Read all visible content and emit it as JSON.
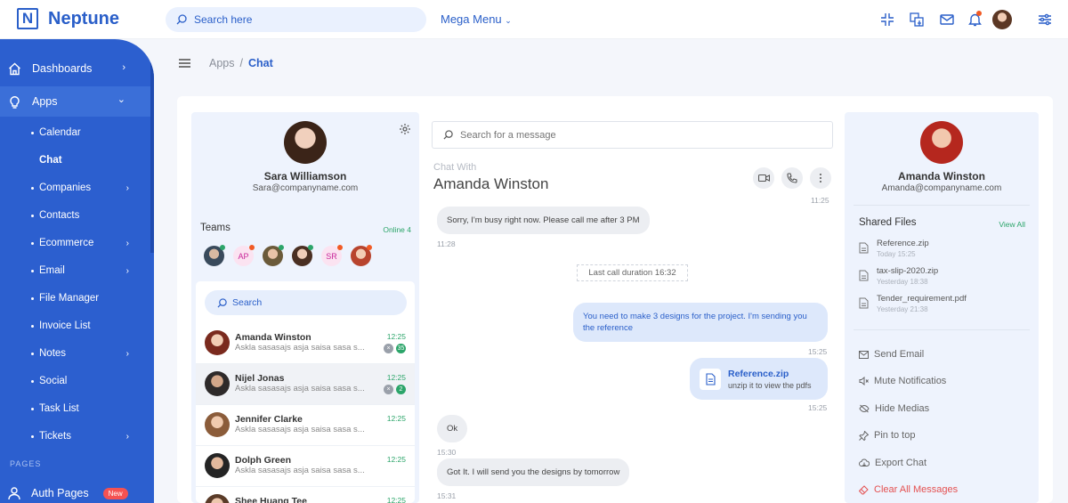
{
  "brand": {
    "mark": "N",
    "name": "Neptune"
  },
  "topbar": {
    "search_placeholder": "Search here",
    "mega_menu": "Mega Menu"
  },
  "sidebar": {
    "dashboards": "Dashboards",
    "apps": "Apps",
    "apps_items": [
      {
        "label": "Calendar"
      },
      {
        "label": "Chat"
      },
      {
        "label": "Companies"
      },
      {
        "label": "Contacts"
      },
      {
        "label": "Ecommerce"
      },
      {
        "label": "Email"
      },
      {
        "label": "File Manager"
      },
      {
        "label": "Invoice List"
      },
      {
        "label": "Notes"
      },
      {
        "label": "Social"
      },
      {
        "label": "Task List"
      },
      {
        "label": "Tickets"
      }
    ],
    "section_pages": "PAGES",
    "auth_pages": "Auth Pages",
    "auth_badge": "New"
  },
  "breadcrumb": {
    "parent": "Apps",
    "separator": "/",
    "current": "Chat"
  },
  "profile": {
    "name": "Sara Williamson",
    "email": "Sara@companyname.com"
  },
  "teams": {
    "title": "Teams",
    "online": "Online 4",
    "members": [
      {
        "initials": ""
      },
      {
        "initials": "AP"
      },
      {
        "initials": ""
      },
      {
        "initials": ""
      },
      {
        "initials": "SR"
      },
      {
        "initials": ""
      }
    ]
  },
  "contacts": {
    "search_placeholder": "Search",
    "items": [
      {
        "name": "Amanda Winston",
        "message": "Askla sasasajs asja saisa sasa s...",
        "time": "12:25",
        "count": "35"
      },
      {
        "name": "Nijel Jonas",
        "message": "Askla sasasajs asja saisa sasa s...",
        "time": "12:25",
        "count": "2"
      },
      {
        "name": "Jennifer Clarke",
        "message": "Askla sasasajs asja saisa sasa s...",
        "time": "12:25",
        "count": ""
      },
      {
        "name": "Dolph Green",
        "message": "Askla sasasajs asja saisa sasa s...",
        "time": "12:25",
        "count": ""
      },
      {
        "name": "Shee Huang Tee",
        "message": "",
        "time": "12:25",
        "count": ""
      }
    ]
  },
  "chat": {
    "search_placeholder": "Search for a message",
    "chat_with_label": "Chat With",
    "partner": "Amanda Winston",
    "top_stamp": "11:25",
    "messages": [
      {
        "text": "Sorry, I'm busy right now. Please call me after 3 PM",
        "time": "11:28"
      },
      {
        "text": "Last call duration 16:32"
      },
      {
        "text": "You need to make 3 designs for the project. I'm sending you the reference",
        "time": "15:25"
      },
      {
        "file": "Reference.zip",
        "text": "unzip it to view the pdfs",
        "time": "15:25"
      },
      {
        "text": "Ok",
        "time": "15:30"
      },
      {
        "text": "Got It. I will send you the designs by tomorrow",
        "time": "15:31"
      }
    ]
  },
  "contact_info": {
    "name": "Amanda Winston",
    "email": "Amanda@companyname.com",
    "shared_title": "Shared Files",
    "view_all": "View All",
    "files": [
      {
        "name": "Reference.zip",
        "date": "Today 15:25"
      },
      {
        "name": "tax-slip-2020.zip",
        "date": "Yesterday 18:38"
      },
      {
        "name": "Tender_requirement.pdf",
        "date": "Yesterday 21:38"
      }
    ],
    "actions": [
      {
        "label": "Send Email",
        "icon": "mail-icon"
      },
      {
        "label": "Mute Notificatios",
        "icon": "mute-icon"
      },
      {
        "label": "Hide Medias",
        "icon": "eye-off-icon"
      },
      {
        "label": "Pin to top",
        "icon": "pin-icon"
      },
      {
        "label": "Export Chat",
        "icon": "cloud-icon"
      },
      {
        "label": "Clear All Messages",
        "icon": "eraser-icon"
      }
    ]
  },
  "colors": {
    "brand": "#2c5fcf",
    "online": "#2ca56a",
    "danger": "#e45050",
    "bubble_out": "#dde8fb"
  }
}
